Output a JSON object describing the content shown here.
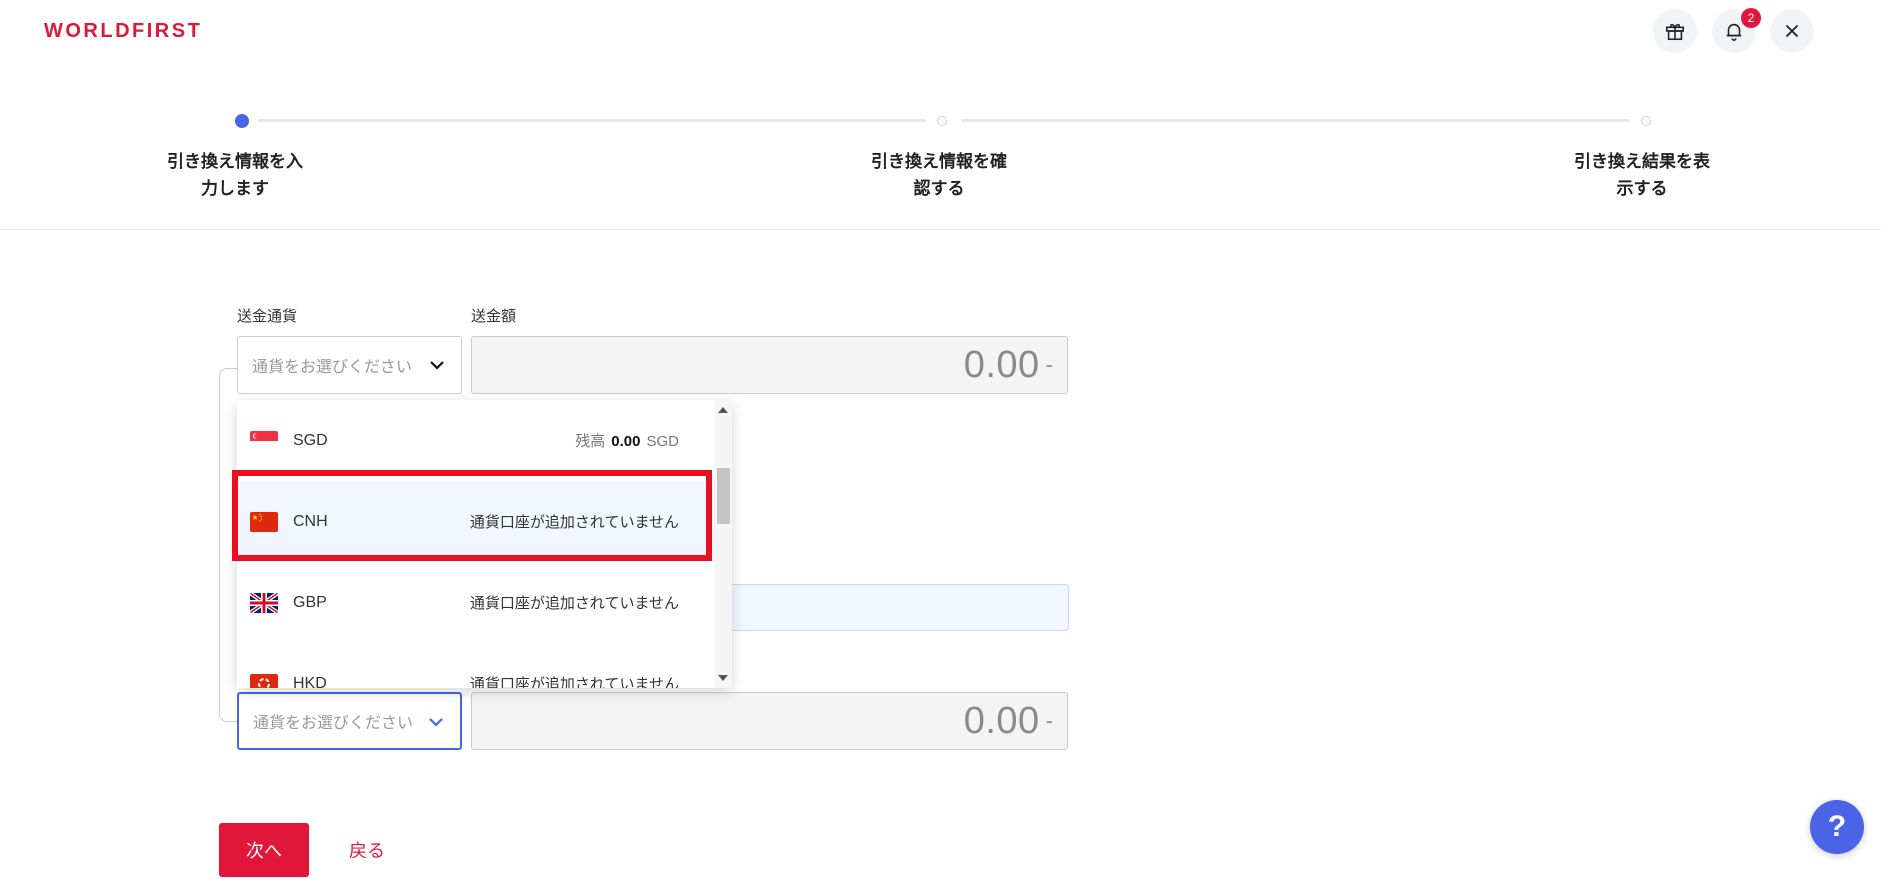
{
  "brand": {
    "logo_text": "WORLDFIRST",
    "accent": "#e0173b",
    "primary": "#4a63e7"
  },
  "header": {
    "icons": [
      "gift-icon",
      "bell-icon",
      "close-icon"
    ],
    "notification_count": "2"
  },
  "stepper": {
    "active_index": 0,
    "steps": [
      {
        "line1": "引き換え情報を入",
        "line2": "力します"
      },
      {
        "line1": "引き換え情報を確",
        "line2": "認する"
      },
      {
        "line1": "引き換え結果を表",
        "line2": "示する"
      }
    ]
  },
  "form": {
    "send_currency_label": "送金通貨",
    "send_amount_label": "送金額",
    "send_currency_placeholder": "通貨をお選びください",
    "send_amount_value": "0.00",
    "send_amount_suffix": "-",
    "receive_currency_placeholder": "通貨をお選びください",
    "receive_amount_value": "0.00",
    "receive_amount_suffix": "-"
  },
  "dropdown": {
    "items": [
      {
        "code": "SGD",
        "flag": "sg-flag",
        "balance_prefix": "残高",
        "balance_value": "0.00",
        "balance_currency": "SGD",
        "status": ""
      },
      {
        "code": "CNH",
        "flag": "cn-flag",
        "status": "通貨口座が追加されていません",
        "highlighted": true
      },
      {
        "code": "GBP",
        "flag": "gb-flag",
        "status": "通貨口座が追加されていません"
      },
      {
        "code": "HKD",
        "flag": "hk-flag",
        "status": "通貨口座が追加されていません"
      }
    ]
  },
  "actions": {
    "next_label": "次へ",
    "back_label": "戻る"
  },
  "help": {
    "label": "?"
  }
}
